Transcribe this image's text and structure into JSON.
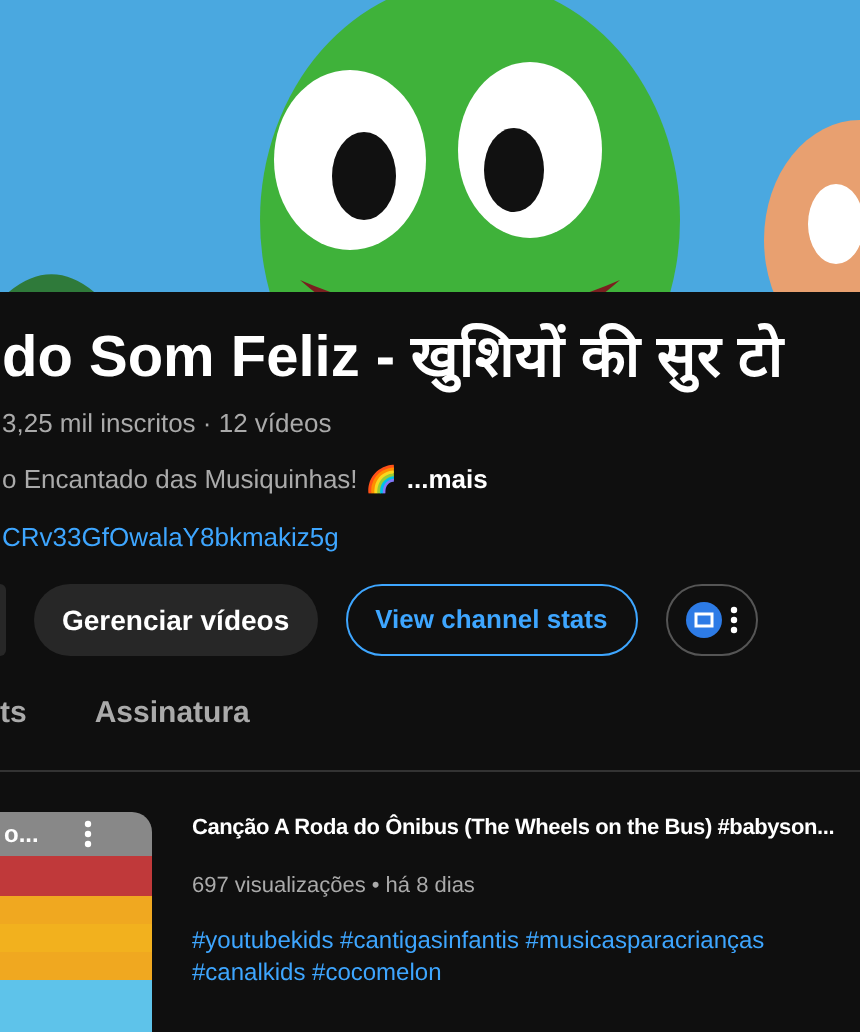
{
  "channel": {
    "title": "do Som Feliz - खुशियों की सुर टो",
    "stats": "3,25 mil inscritos · 12 vídeos",
    "description": "o Encantado das Musiquinhas! 🌈",
    "more": "...mais",
    "link": "CRv33GfOwalaY8bkmakiz5g"
  },
  "actions": [
    {
      "kind": "filled",
      "label": "Gerenciar vídeos"
    },
    {
      "kind": "outlined",
      "label": "View channel stats"
    },
    {
      "kind": "extension"
    }
  ],
  "tabs": [
    {
      "label": "ts",
      "selected": false
    },
    {
      "label": "Assinatura",
      "selected": false
    }
  ],
  "videos": [
    {
      "thumbnail_text": "o...",
      "title": "Canção A Roda do Ônibus (The Wheels on the Bus) #babyson...",
      "meta": "697 visualizações • há 8 dias",
      "hashtags": "#youtubekids #cantigasinfantis #musicasparacrianças #canalkids #cocomelon"
    }
  ]
}
